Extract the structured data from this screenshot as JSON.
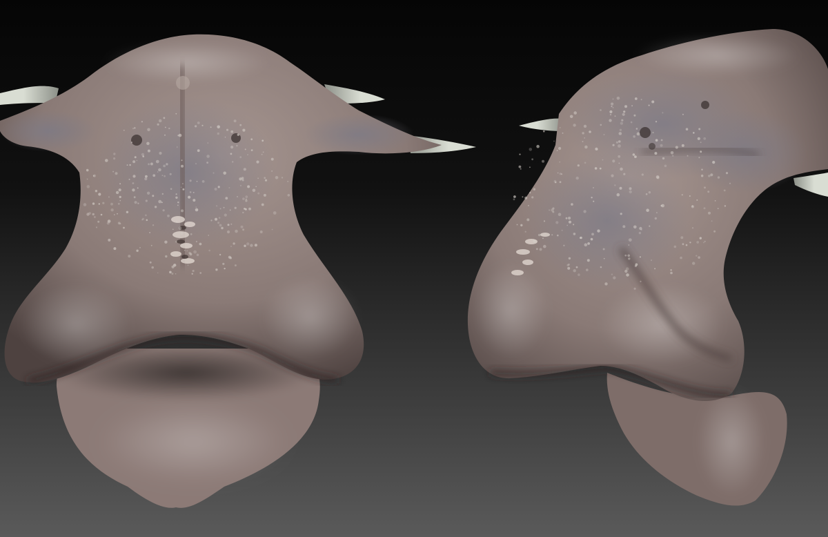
{
  "scene": {
    "background_top": "#050505",
    "background_bottom": "#5a5a5a",
    "skin_light": "#a59590",
    "skin_mid": "#8a7a76",
    "skin_dark": "#4e4240",
    "skin_cool": "#7c7a86",
    "horn_light": "#d9ddd3",
    "horn_dark": "#8c9088",
    "freckle": "#d8d2cc",
    "views": [
      {
        "name": "front-view",
        "subject": "creature-head-sculpt"
      },
      {
        "name": "three-quarter-view",
        "subject": "creature-head-sculpt"
      }
    ]
  }
}
